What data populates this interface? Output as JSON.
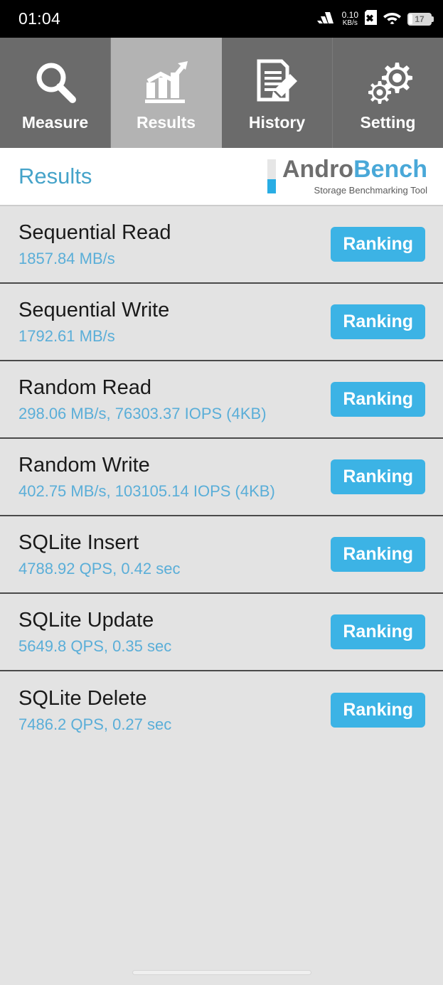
{
  "status_bar": {
    "clock": "01:04",
    "network_speed_value": "0.10",
    "network_speed_unit": "KB/s",
    "signal_icon": "signal-bars-icon",
    "sim_icon": "sim-card-disabled-icon",
    "wifi_icon": "wifi-icon",
    "battery_level": "17"
  },
  "tabs": [
    {
      "label": "Measure",
      "icon": "magnifier-icon",
      "active": false
    },
    {
      "label": "Results",
      "icon": "bar-chart-trend-icon",
      "active": true
    },
    {
      "label": "History",
      "icon": "document-pencil-icon",
      "active": false
    },
    {
      "label": "Setting",
      "icon": "gears-icon",
      "active": false
    }
  ],
  "header": {
    "page_title": "Results",
    "logo_primary": "Andro",
    "logo_secondary": "Bench",
    "logo_subtitle": "Storage Benchmarking Tool"
  },
  "results": [
    {
      "name": "Sequential Read",
      "value": "1857.84 MB/s",
      "button": "Ranking"
    },
    {
      "name": "Sequential Write",
      "value": "1792.61 MB/s",
      "button": "Ranking"
    },
    {
      "name": "Random Read",
      "value": "298.06 MB/s, 76303.37 IOPS (4KB)",
      "button": "Ranking"
    },
    {
      "name": "Random Write",
      "value": "402.75 MB/s, 103105.14 IOPS (4KB)",
      "button": "Ranking"
    },
    {
      "name": "SQLite Insert",
      "value": "4788.92 QPS, 0.42 sec",
      "button": "Ranking"
    },
    {
      "name": "SQLite Update",
      "value": "5649.8 QPS, 0.35 sec",
      "button": "Ranking"
    },
    {
      "name": "SQLite Delete",
      "value": "7486.2 QPS, 0.27 sec",
      "button": "Ranking"
    }
  ],
  "colors": {
    "accent_blue": "#3cb3e5",
    "value_blue": "#5aaed8",
    "title_blue": "#45a3c9",
    "tab_inactive": "#6b6b6b",
    "tab_active": "#b3b3b3",
    "list_background": "#e3e3e3",
    "status_bar_background": "#000000"
  }
}
